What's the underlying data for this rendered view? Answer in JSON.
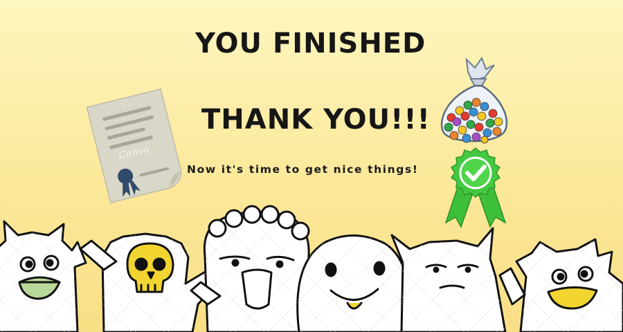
{
  "heading": {
    "line1": "YOU FINISHED",
    "line2": "THANK YOU!!!"
  },
  "message": "Now it's time to get nice things!",
  "watermark": "Canva",
  "icons": [
    "certificate-icon",
    "candy-bag-icon",
    "checkmark-badge-icon",
    "monster-group-illustration"
  ],
  "colors": {
    "background_top": "#fdf6bf",
    "background_bottom": "#f9df86",
    "text": "#161616",
    "badge_green": "#3dbf3a",
    "certificate_paper": "#d8d6c6",
    "ribbon_blue": "#2f4a6b",
    "skull_yellow": "#f2d531"
  }
}
